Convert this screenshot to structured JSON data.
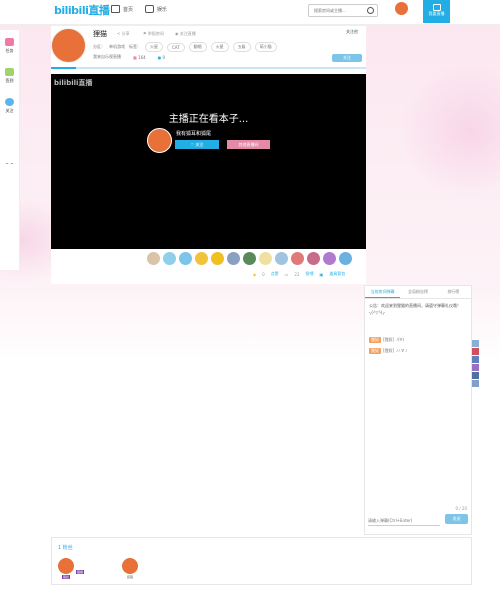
{
  "header": {
    "logo": "bilibili直播",
    "nav": [
      {
        "label": "首页",
        "icon": "tv-icon"
      },
      {
        "label": "娱乐",
        "icon": "bili-icon"
      }
    ],
    "search_placeholder": "搜索房间或主播...",
    "live_button": "我要直播"
  },
  "sidebar": {
    "items": [
      {
        "label": "任务",
        "color": "#ef7aa8"
      },
      {
        "label": "签到",
        "color": "#9ed46a"
      },
      {
        "label": "关注",
        "color": "#5bb5e8"
      }
    ]
  },
  "room": {
    "anchor_name": "狸猫",
    "share": "分享",
    "report": "举报房间",
    "watch": "关注直播",
    "attention": "关注他",
    "area_label": "分区：",
    "area": "单机游戏",
    "tags_label": "标签：",
    "tags": [
      "火星",
      "CAT",
      "翻唱",
      "火星",
      "五级",
      "萌小猫"
    ],
    "room_note": "我来自乐视直播",
    "fans_count": "164",
    "medal_count": "0",
    "follow_button": "关注",
    "progress_pct": 8
  },
  "player": {
    "logo": "bilibili直播",
    "offline_title": "主播正在看本子...",
    "anchor_display": "我有狐耳和狐尾",
    "follow": "关注",
    "other_rooms": "其他直播间"
  },
  "gifts": [
    "#d9c4a8",
    "#8ecfea",
    "#7cc4e8",
    "#f2c23a",
    "#f0c020",
    "#8aa0c0",
    "#5a8a5a",
    "#f0e0a0",
    "#a0c4e0",
    "#e07a7a",
    "#c86a8a",
    "#b07ad0",
    "#6ab0e0"
  ],
  "stats": {
    "likes": "0",
    "likes_label": "点赞",
    "shares": "22",
    "shares_label": "投喂",
    "gift_label": "道具背包"
  },
  "chat": {
    "tabs": [
      "当前房间弹幕",
      "全局粉丝榜",
      "排行榜"
    ],
    "notice": "公告：欢迎来到狸猫的直播间，请遵守弹幕礼仪哦！ ╮(╯▽╰)╭",
    "messages": [
      {
        "medal": "狸奴",
        "user": "[狸奴]",
        "text": "ﾉ(∀)"
      },
      {
        "medal": "狸奴",
        "user": "[狸奴]",
        "text": "ﾉﾉ ∀ ﾉ"
      }
    ],
    "count": "0 / 20",
    "input_placeholder": "请输入弹幕(Ctrl+Enter)",
    "send": "发送"
  },
  "tools": [
    "#8ab0d8",
    "#d05060",
    "#6080c0",
    "#9a70c0",
    "#5070a0",
    "#80a0c8"
  ],
  "fans": {
    "count_label": "1 粉丝",
    "list": [
      {
        "badge": "狸奴",
        "label": "狸猫"
      },
      {
        "badge": "狸奴",
        "label": "狐狸"
      }
    ]
  }
}
